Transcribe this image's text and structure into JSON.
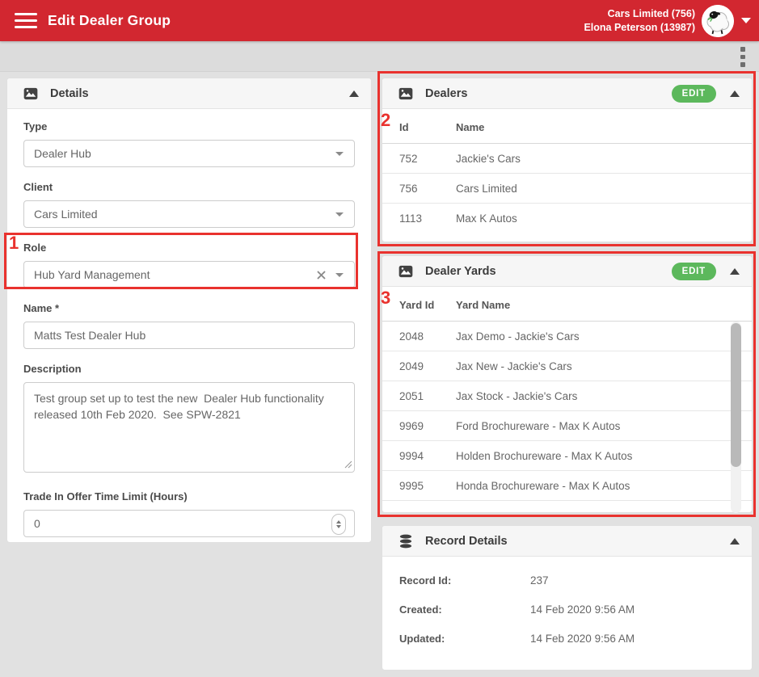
{
  "colors": {
    "header_red": "#d22730",
    "annotation_red": "#e9322e",
    "edit_green": "#5cb85c",
    "toolbar_bg": "#dcdcdc",
    "page_bg": "#e1e1e1"
  },
  "header": {
    "title": "Edit Dealer Group",
    "account_line1": "Cars Limited (756)",
    "account_line2": "Elona Peterson (13987)"
  },
  "details_panel": {
    "title": "Details",
    "fields": {
      "type": {
        "label": "Type",
        "value": "Dealer Hub"
      },
      "client": {
        "label": "Client",
        "value": "Cars Limited"
      },
      "role": {
        "label": "Role",
        "value": "Hub Yard Management"
      },
      "name": {
        "label": "Name *",
        "value": "Matts Test Dealer Hub"
      },
      "description": {
        "label": "Description",
        "value": "Test group set up to test the new  Dealer Hub functionality released 10th Feb 2020.  See SPW-2821"
      },
      "trade_in": {
        "label": "Trade In Offer Time Limit (Hours)",
        "value": "0"
      }
    }
  },
  "dealers_panel": {
    "title": "Dealers",
    "edit_label": "EDIT",
    "columns": {
      "id": "Id",
      "name": "Name"
    },
    "rows": [
      [
        "752",
        "Jackie's Cars"
      ],
      [
        "756",
        "Cars Limited"
      ],
      [
        "1113",
        "Max K Autos"
      ]
    ]
  },
  "dealer_yards_panel": {
    "title": "Dealer Yards",
    "edit_label": "EDIT",
    "columns": {
      "id": "Yard Id",
      "name": "Yard Name"
    },
    "rows": [
      [
        "2048",
        "Jax Demo - Jackie's Cars"
      ],
      [
        "2049",
        "Jax New - Jackie's Cars"
      ],
      [
        "2051",
        "Jax Stock - Jackie's Cars"
      ],
      [
        "9969",
        "Ford Brochureware - Max K Autos"
      ],
      [
        "9994",
        "Holden Brochureware - Max K Autos"
      ],
      [
        "9995",
        "Honda Brochureware - Max K Autos"
      ]
    ]
  },
  "record_details_panel": {
    "title": "Record Details",
    "rows": [
      {
        "label": "Record Id:",
        "value": "237"
      },
      {
        "label": "Created:",
        "value": "14 Feb 2020 9:56 AM"
      },
      {
        "label": "Updated:",
        "value": "14 Feb 2020 9:56 AM"
      }
    ]
  },
  "annotations": {
    "one": "1",
    "two": "2",
    "three": "3"
  }
}
